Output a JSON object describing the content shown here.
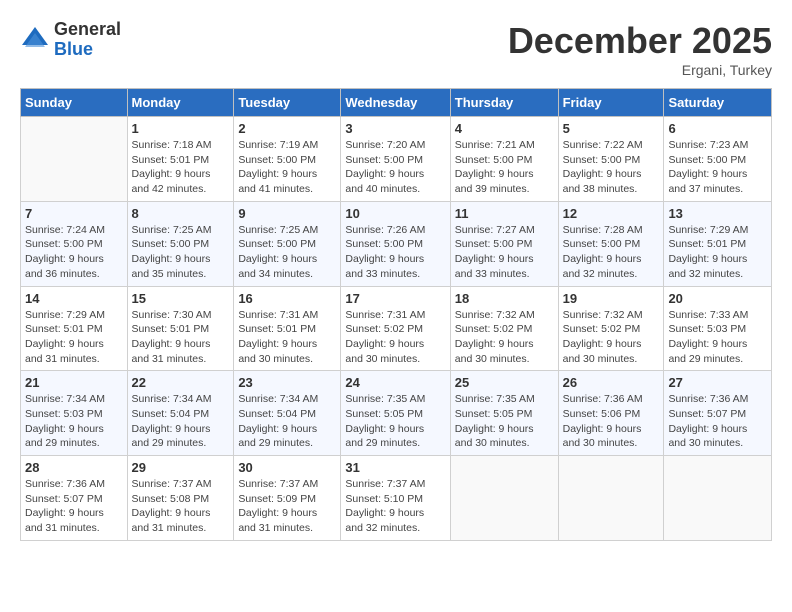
{
  "logo": {
    "general": "General",
    "blue": "Blue"
  },
  "header": {
    "month": "December 2025",
    "location": "Ergani, Turkey"
  },
  "weekdays": [
    "Sunday",
    "Monday",
    "Tuesday",
    "Wednesday",
    "Thursday",
    "Friday",
    "Saturday"
  ],
  "weeks": [
    [
      {
        "day": "",
        "info": ""
      },
      {
        "day": "1",
        "info": "Sunrise: 7:18 AM\nSunset: 5:01 PM\nDaylight: 9 hours\nand 42 minutes."
      },
      {
        "day": "2",
        "info": "Sunrise: 7:19 AM\nSunset: 5:00 PM\nDaylight: 9 hours\nand 41 minutes."
      },
      {
        "day": "3",
        "info": "Sunrise: 7:20 AM\nSunset: 5:00 PM\nDaylight: 9 hours\nand 40 minutes."
      },
      {
        "day": "4",
        "info": "Sunrise: 7:21 AM\nSunset: 5:00 PM\nDaylight: 9 hours\nand 39 minutes."
      },
      {
        "day": "5",
        "info": "Sunrise: 7:22 AM\nSunset: 5:00 PM\nDaylight: 9 hours\nand 38 minutes."
      },
      {
        "day": "6",
        "info": "Sunrise: 7:23 AM\nSunset: 5:00 PM\nDaylight: 9 hours\nand 37 minutes."
      }
    ],
    [
      {
        "day": "7",
        "info": "Sunrise: 7:24 AM\nSunset: 5:00 PM\nDaylight: 9 hours\nand 36 minutes."
      },
      {
        "day": "8",
        "info": "Sunrise: 7:25 AM\nSunset: 5:00 PM\nDaylight: 9 hours\nand 35 minutes."
      },
      {
        "day": "9",
        "info": "Sunrise: 7:25 AM\nSunset: 5:00 PM\nDaylight: 9 hours\nand 34 minutes."
      },
      {
        "day": "10",
        "info": "Sunrise: 7:26 AM\nSunset: 5:00 PM\nDaylight: 9 hours\nand 33 minutes."
      },
      {
        "day": "11",
        "info": "Sunrise: 7:27 AM\nSunset: 5:00 PM\nDaylight: 9 hours\nand 33 minutes."
      },
      {
        "day": "12",
        "info": "Sunrise: 7:28 AM\nSunset: 5:00 PM\nDaylight: 9 hours\nand 32 minutes."
      },
      {
        "day": "13",
        "info": "Sunrise: 7:29 AM\nSunset: 5:01 PM\nDaylight: 9 hours\nand 32 minutes."
      }
    ],
    [
      {
        "day": "14",
        "info": "Sunrise: 7:29 AM\nSunset: 5:01 PM\nDaylight: 9 hours\nand 31 minutes."
      },
      {
        "day": "15",
        "info": "Sunrise: 7:30 AM\nSunset: 5:01 PM\nDaylight: 9 hours\nand 31 minutes."
      },
      {
        "day": "16",
        "info": "Sunrise: 7:31 AM\nSunset: 5:01 PM\nDaylight: 9 hours\nand 30 minutes."
      },
      {
        "day": "17",
        "info": "Sunrise: 7:31 AM\nSunset: 5:02 PM\nDaylight: 9 hours\nand 30 minutes."
      },
      {
        "day": "18",
        "info": "Sunrise: 7:32 AM\nSunset: 5:02 PM\nDaylight: 9 hours\nand 30 minutes."
      },
      {
        "day": "19",
        "info": "Sunrise: 7:32 AM\nSunset: 5:02 PM\nDaylight: 9 hours\nand 30 minutes."
      },
      {
        "day": "20",
        "info": "Sunrise: 7:33 AM\nSunset: 5:03 PM\nDaylight: 9 hours\nand 29 minutes."
      }
    ],
    [
      {
        "day": "21",
        "info": "Sunrise: 7:34 AM\nSunset: 5:03 PM\nDaylight: 9 hours\nand 29 minutes."
      },
      {
        "day": "22",
        "info": "Sunrise: 7:34 AM\nSunset: 5:04 PM\nDaylight: 9 hours\nand 29 minutes."
      },
      {
        "day": "23",
        "info": "Sunrise: 7:34 AM\nSunset: 5:04 PM\nDaylight: 9 hours\nand 29 minutes."
      },
      {
        "day": "24",
        "info": "Sunrise: 7:35 AM\nSunset: 5:05 PM\nDaylight: 9 hours\nand 29 minutes."
      },
      {
        "day": "25",
        "info": "Sunrise: 7:35 AM\nSunset: 5:05 PM\nDaylight: 9 hours\nand 30 minutes."
      },
      {
        "day": "26",
        "info": "Sunrise: 7:36 AM\nSunset: 5:06 PM\nDaylight: 9 hours\nand 30 minutes."
      },
      {
        "day": "27",
        "info": "Sunrise: 7:36 AM\nSunset: 5:07 PM\nDaylight: 9 hours\nand 30 minutes."
      }
    ],
    [
      {
        "day": "28",
        "info": "Sunrise: 7:36 AM\nSunset: 5:07 PM\nDaylight: 9 hours\nand 31 minutes."
      },
      {
        "day": "29",
        "info": "Sunrise: 7:37 AM\nSunset: 5:08 PM\nDaylight: 9 hours\nand 31 minutes."
      },
      {
        "day": "30",
        "info": "Sunrise: 7:37 AM\nSunset: 5:09 PM\nDaylight: 9 hours\nand 31 minutes."
      },
      {
        "day": "31",
        "info": "Sunrise: 7:37 AM\nSunset: 5:10 PM\nDaylight: 9 hours\nand 32 minutes."
      },
      {
        "day": "",
        "info": ""
      },
      {
        "day": "",
        "info": ""
      },
      {
        "day": "",
        "info": ""
      }
    ]
  ]
}
